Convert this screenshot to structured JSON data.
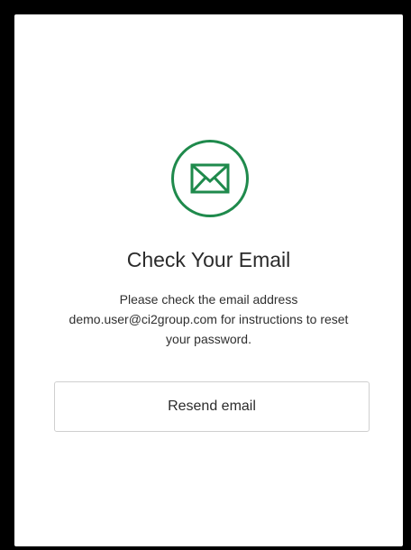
{
  "title": "Check Your Email",
  "message": {
    "line1": "Please check the email address",
    "line2": "demo.user@ci2group.com for instructions to reset",
    "line3": "your password."
  },
  "resend_button": {
    "label": "Resend email"
  },
  "icons": {
    "status_icon": "envelope-icon"
  },
  "colors": {
    "accent": "#1f8a4c",
    "backdrop": "#000000",
    "card": "#ffffff",
    "text": "#2b2b2b",
    "button_border": "#cfcfcf"
  }
}
